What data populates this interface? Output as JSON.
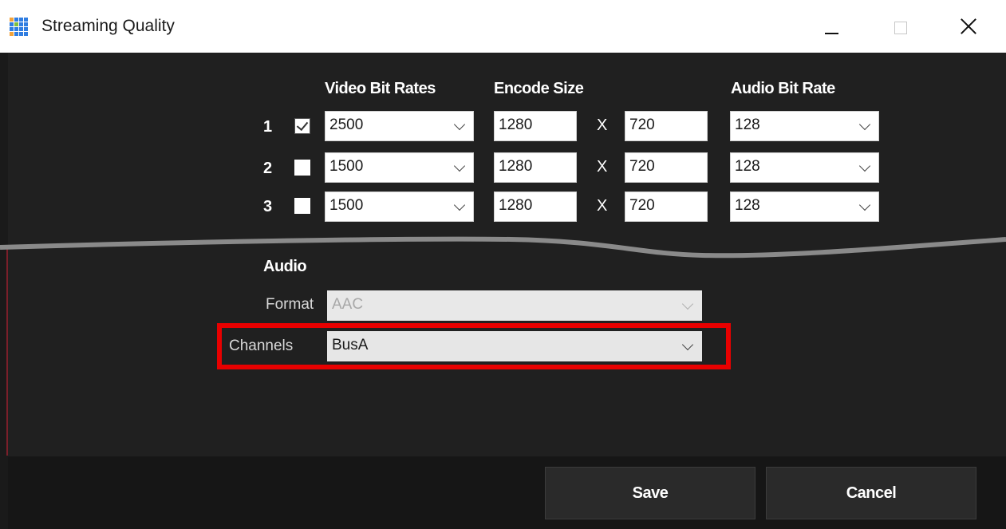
{
  "window": {
    "title": "Streaming Quality",
    "icon": "app-grid-icon"
  },
  "headers": {
    "video_bit_rates": "Video Bit Rates",
    "encode_size": "Encode Size",
    "audio_bit_rate": "Audio Bit Rate"
  },
  "rows": [
    {
      "num": "1",
      "checked": true,
      "video_bit_rate": "2500",
      "width": "1280",
      "x": "X",
      "height": "720",
      "audio_bit_rate": "128"
    },
    {
      "num": "2",
      "checked": false,
      "video_bit_rate": "1500",
      "width": "1280",
      "x": "X",
      "height": "720",
      "audio_bit_rate": "128"
    },
    {
      "num": "3",
      "checked": false,
      "video_bit_rate": "1500",
      "width": "1280",
      "x": "X",
      "height": "720",
      "audio_bit_rate": "128"
    }
  ],
  "audio": {
    "section_label": "Audio",
    "format_label": "Format",
    "format_value": "AAC",
    "channels_label": "Channels",
    "channels_value": "BusA"
  },
  "buttons": {
    "save": "Save",
    "cancel": "Cancel"
  },
  "colors": {
    "highlight": "#e80000",
    "dialog_bg": "#202020"
  }
}
